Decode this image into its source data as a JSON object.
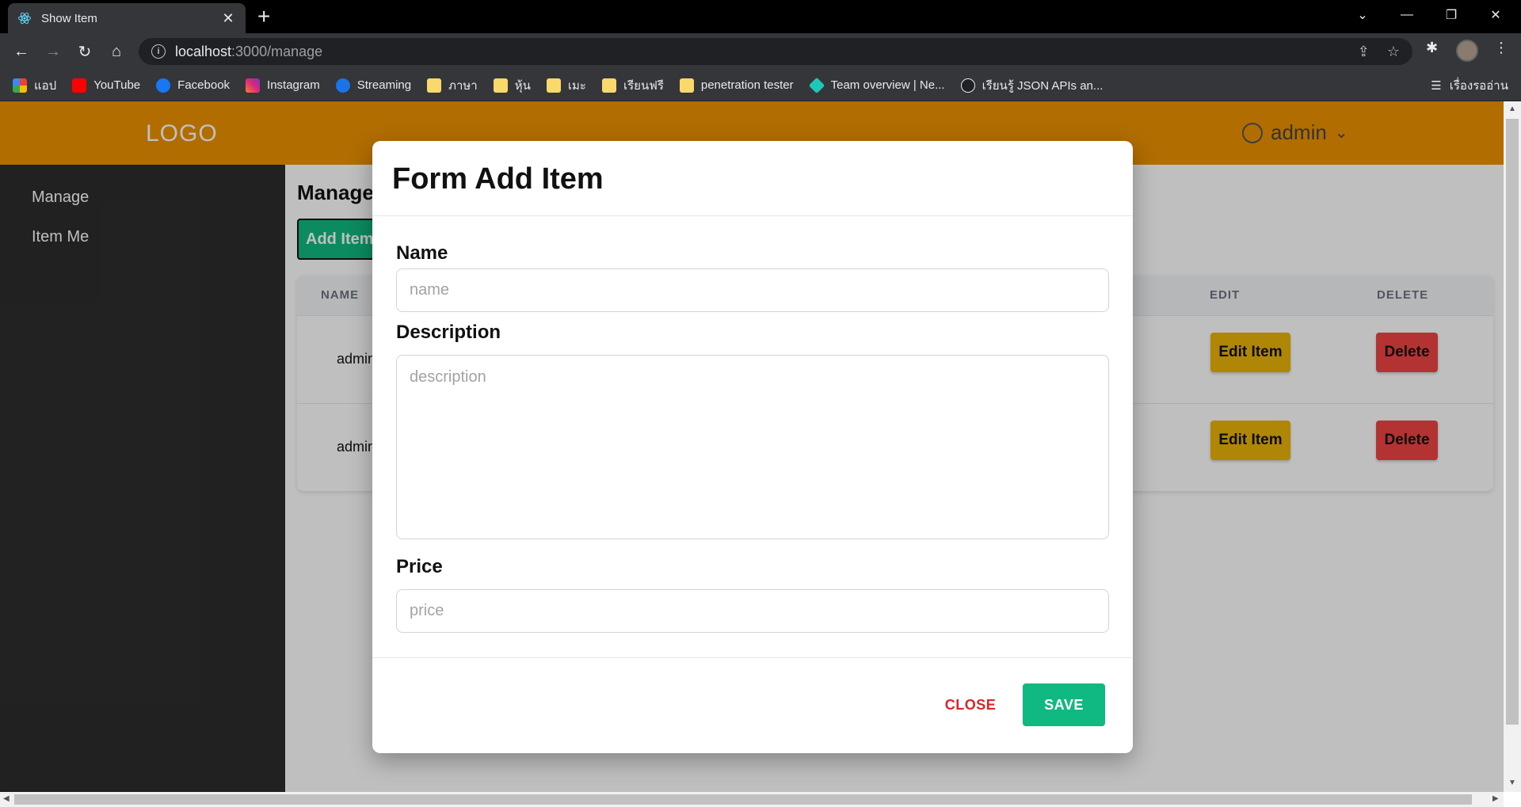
{
  "browser": {
    "tab_title": "Show Item",
    "url_host": "localhost",
    "url_path": ":3000/manage",
    "bookmarks": [
      {
        "label": "แอป",
        "icon": "apps-grid-icon",
        "color": "#4285f4"
      },
      {
        "label": "YouTube",
        "icon": "youtube-icon",
        "color": "#ff0000"
      },
      {
        "label": "Facebook",
        "icon": "facebook-icon",
        "color": "#1877f2"
      },
      {
        "label": "Instagram",
        "icon": "instagram-icon",
        "color": "#e1306c"
      },
      {
        "label": "Streaming",
        "icon": "streaming-icon",
        "color": "#1a73e8"
      },
      {
        "label": "ภาษา",
        "icon": "folder-icon",
        "color": "#f9d96b"
      },
      {
        "label": "หุ้น",
        "icon": "folder-icon",
        "color": "#f9d96b"
      },
      {
        "label": "เมะ",
        "icon": "folder-icon",
        "color": "#f9d96b"
      },
      {
        "label": "เรียนฟรี",
        "icon": "folder-icon",
        "color": "#f9d96b"
      },
      {
        "label": "penetration tester",
        "icon": "folder-icon",
        "color": "#f9d96b"
      },
      {
        "label": "Team overview | Ne...",
        "icon": "netlify-icon",
        "color": "#20c6b7"
      },
      {
        "label": "เรียนรู้ JSON APIs an...",
        "icon": "angular-icon",
        "color": "#202124"
      }
    ],
    "reading_list": "เรื่องรออ่าน"
  },
  "app": {
    "logo": "LOGO",
    "user": "admin",
    "sidebar": [
      "Manage",
      "Item Me"
    ],
    "page_title": "Manage",
    "add_button": "Add Item",
    "table": {
      "headers": {
        "name": "NAME",
        "edit": "EDIT",
        "delete": "DELETE"
      },
      "rows": [
        {
          "name": "admin",
          "edit": "Edit Item",
          "delete": "Delete"
        },
        {
          "name": "admin",
          "edit": "Edit Item",
          "delete": "Delete"
        }
      ]
    }
  },
  "modal": {
    "title": "Form Add Item",
    "fields": {
      "name": {
        "label": "Name",
        "placeholder": "name",
        "value": ""
      },
      "description": {
        "label": "Description",
        "placeholder": "description",
        "value": ""
      },
      "price": {
        "label": "Price",
        "placeholder": "price",
        "value": ""
      }
    },
    "close_label": "CLOSE",
    "save_label": "SAVE"
  },
  "colors": {
    "header": "#ed9200",
    "sidebar": "#2d2d2d",
    "primary": "#10b981",
    "edit": "#eab308",
    "delete": "#ef4444",
    "close_text": "#dc2626"
  }
}
